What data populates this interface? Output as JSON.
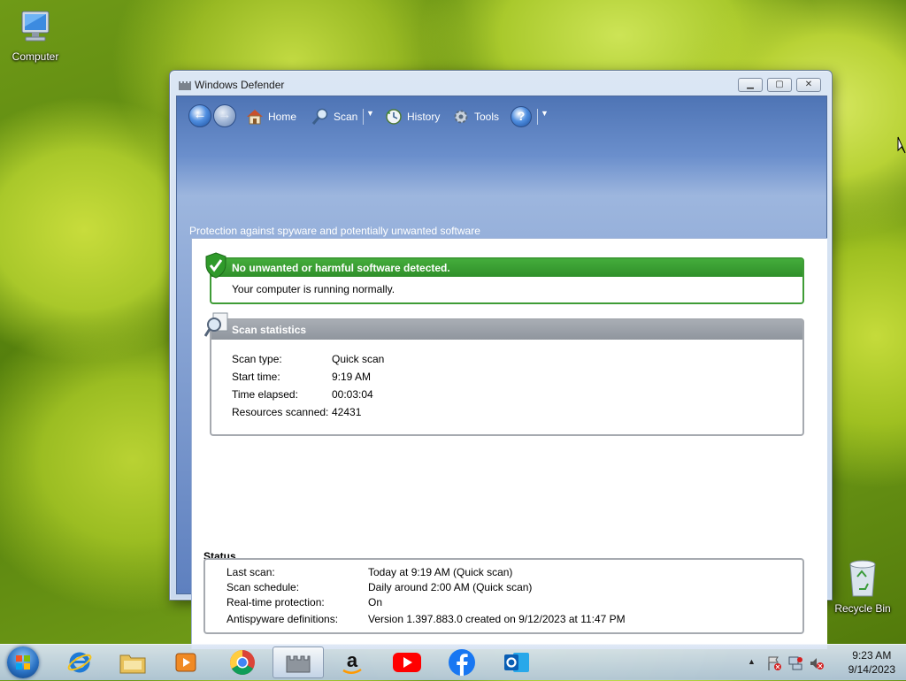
{
  "desktop": {
    "icons": [
      {
        "label": "Computer"
      },
      {
        "label": "Recycle Bin"
      }
    ]
  },
  "window": {
    "title": "Windows Defender",
    "toolbar": {
      "home": "Home",
      "scan": "Scan",
      "history": "History",
      "tools": "Tools",
      "help": "?"
    },
    "subtitle": "Protection against spyware and potentially unwanted software",
    "alert": {
      "heading": "No unwanted or harmful software detected.",
      "message": "Your computer is running normally.",
      "color": "#3f9c36"
    },
    "scan_statistics": {
      "heading": "Scan statistics",
      "rows": [
        {
          "label": "Scan type:",
          "value": "Quick scan"
        },
        {
          "label": "Start time:",
          "value": "9:19 AM"
        },
        {
          "label": "Time elapsed:",
          "value": "00:03:04"
        },
        {
          "label": "Resources scanned:",
          "value": "42431"
        }
      ]
    },
    "status": {
      "heading": "Status",
      "rows": [
        {
          "label": "Last scan:",
          "value": "Today at 9:19 AM (Quick scan)"
        },
        {
          "label": "Scan schedule:",
          "value": "Daily around 2:00 AM (Quick scan)"
        },
        {
          "label": "Real-time protection:",
          "value": "On"
        },
        {
          "label": "Antispyware definitions:",
          "value": "Version 1.397.883.0 created on 9/12/2023 at 11:47 PM"
        }
      ]
    }
  },
  "taskbar": {
    "apps": [
      "start-orb",
      "internet-explorer-icon",
      "file-explorer-icon",
      "media-player-icon",
      "chrome-icon",
      "windows-defender-icon",
      "amazon-icon",
      "youtube-icon",
      "facebook-icon",
      "outlook-icon"
    ],
    "clock": {
      "time": "9:23 AM",
      "date": "9/14/2023"
    }
  }
}
